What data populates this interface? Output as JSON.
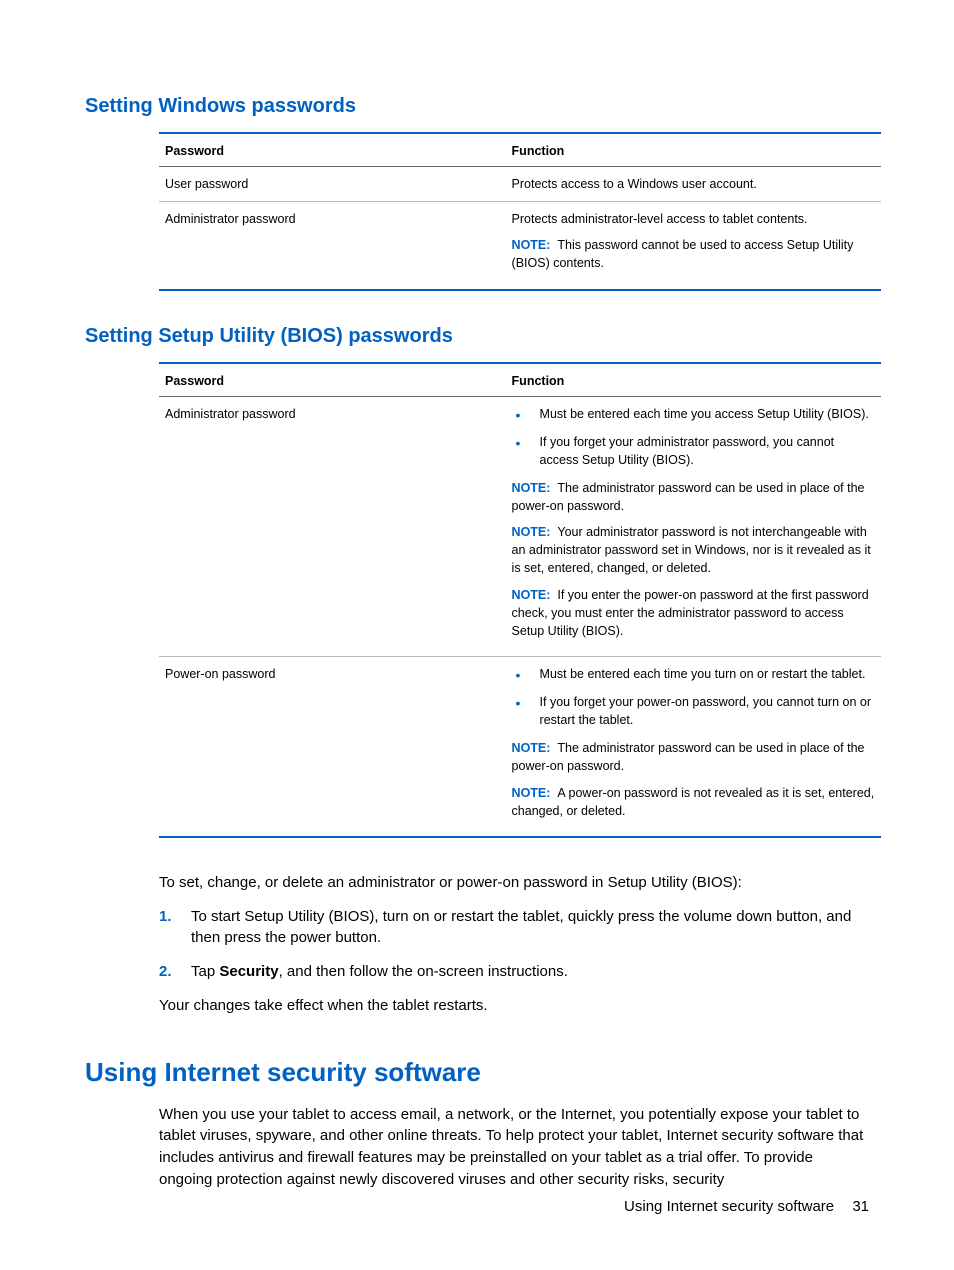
{
  "section1": {
    "heading": "Setting Windows passwords",
    "th1": "Password",
    "th2": "Function",
    "rows": [
      {
        "c1": "User password",
        "c2": "Protects access to a Windows user account."
      },
      {
        "c1": "Administrator password",
        "c2": "Protects administrator-level access to tablet contents.",
        "noteLabel": "NOTE:",
        "noteText": "This password cannot be used to access Setup Utility (BIOS) contents."
      }
    ]
  },
  "section2": {
    "heading": "Setting Setup Utility (BIOS) passwords",
    "th1": "Password",
    "th2": "Function",
    "r1": {
      "c1": "Administrator password",
      "b1": "Must be entered each time you access Setup Utility (BIOS).",
      "b2": "If you forget your administrator password, you cannot access Setup Utility (BIOS).",
      "noteLabel": "NOTE:",
      "n1": "The administrator password can be used in place of the power-on password.",
      "n2": "Your administrator password is not interchangeable with an administrator password set in Windows, nor is it revealed as it is set, entered, changed, or deleted.",
      "n3": "If you enter the power-on password at the first password check, you must enter the administrator password to access Setup Utility (BIOS)."
    },
    "r2": {
      "c1": "Power-on password",
      "b1": "Must be entered each time you turn on or restart the tablet.",
      "b2": "If you forget your power-on password, you cannot turn on or restart the tablet.",
      "noteLabel": "NOTE:",
      "n1": "The administrator password can be used in place of the power-on password.",
      "n2": "A power-on password is not revealed as it is set, entered, changed, or deleted."
    }
  },
  "body": {
    "intro": "To set, change, or delete an administrator or power-on password in Setup Utility (BIOS):",
    "step1num": "1.",
    "step1": "To start Setup Utility (BIOS), turn on or restart the tablet, quickly press the volume down button, and then press the power button.",
    "step2num": "2.",
    "step2a": "Tap ",
    "step2bold": "Security",
    "step2b": ", and then follow the on-screen instructions.",
    "after": "Your changes take effect when the tablet restarts."
  },
  "section3": {
    "heading": "Using Internet security software",
    "p1": "When you use your tablet to access email, a network, or the Internet, you potentially expose your tablet to tablet viruses, spyware, and other online threats. To help protect your tablet, Internet security software that includes antivirus and firewall features may be preinstalled on your tablet as a trial offer. To provide ongoing protection against newly discovered viruses and other security risks, security"
  },
  "footer": {
    "text": "Using Internet security software",
    "page": "31"
  }
}
